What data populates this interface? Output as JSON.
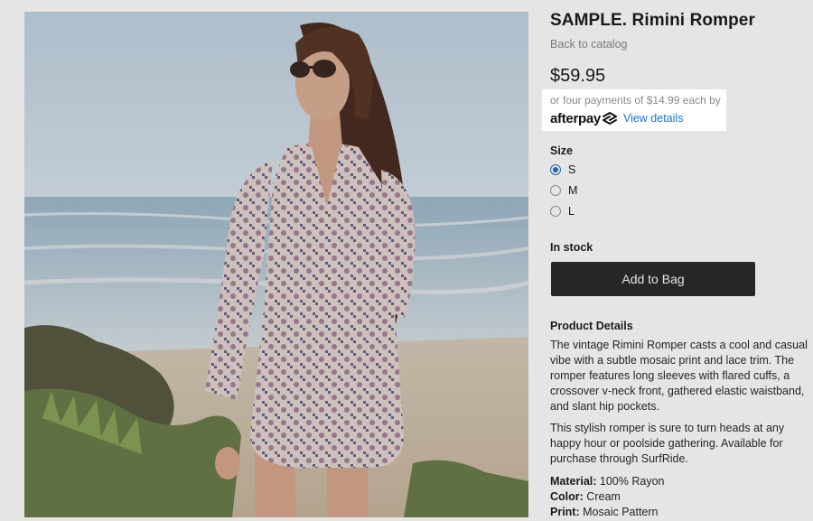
{
  "product": {
    "title": "SAMPLE. Rimini Romper",
    "back_link": "Back to catalog",
    "price": "$59.95",
    "image_alt": "Woman wearing printed romper by the ocean"
  },
  "afterpay": {
    "text": "or four payments of $14.99 each by",
    "logo_text": "afterpay",
    "details_link": "View details"
  },
  "size": {
    "label": "Size",
    "options": [
      {
        "label": "S",
        "selected": true
      },
      {
        "label": "M",
        "selected": false
      },
      {
        "label": "L",
        "selected": false
      }
    ]
  },
  "stock": "In stock",
  "add_to_bag": "Add to Bag",
  "details": {
    "heading": "Product Details",
    "paragraph1": "The vintage Rimini Romper casts a cool and casual vibe with a subtle mosaic print and lace trim. The romper features long sleeves with flared cuffs, a crossover v-neck front, gathered elastic waistband, and slant hip pockets.",
    "paragraph2": "This stylish romper is sure to turn heads at any happy hour or poolside gathering. Available for purchase through SurfRide.",
    "specs": [
      {
        "key": "Material:",
        "value": "100% Rayon"
      },
      {
        "key": "Color:",
        "value": "Cream"
      },
      {
        "key": "Print:",
        "value": "Mosaic Pattern"
      }
    ]
  },
  "colors": {
    "button_bg": "#2b2b2b",
    "link_blue": "#1a73c9",
    "radio_blue": "#2f6fbd"
  }
}
